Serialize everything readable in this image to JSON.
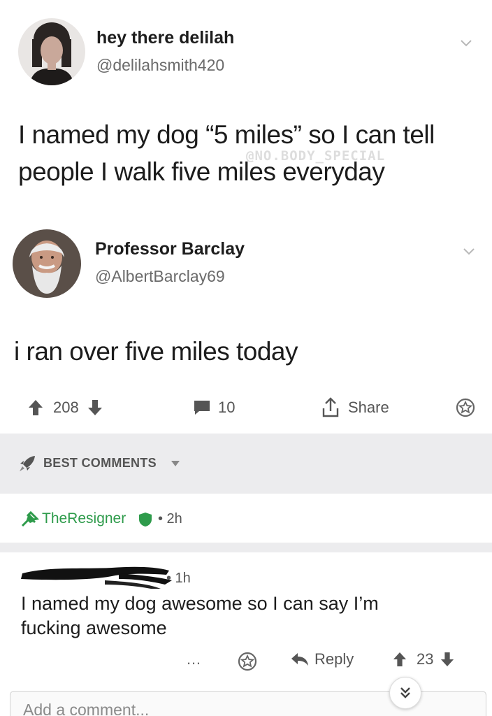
{
  "tweet1": {
    "name": "hey there delilah",
    "handle": "@delilahsmith420",
    "text": "I named my dog “5 miles” so I can tell people I walk five miles everyday",
    "watermark": "@NO.BODY_SPECIAL"
  },
  "tweet2": {
    "name": "Professor Barclay",
    "handle": "@AlbertBarclay69",
    "text": "i ran over five miles today"
  },
  "post_actions": {
    "score": "208",
    "comments": "10",
    "share_label": "Share"
  },
  "best_comments_label": "BEST COMMENTS",
  "comment1": {
    "author": "TheResigner",
    "time": "• 2h"
  },
  "comment2": {
    "time": "• 1h",
    "text": "I named my dog awesome so I can say I’m fucking awesome",
    "more": "…",
    "reply_label": "Reply",
    "score": "23"
  },
  "add_comment": {
    "placeholder": "Add a comment..."
  },
  "colors": {
    "accent_green": "#2e9b4b",
    "section_gray": "#ececee",
    "text_gray": "#555555"
  },
  "icons": {
    "upvote": "upvote-arrow-icon",
    "downvote": "downvote-arrow-icon",
    "comment": "comment-bubble-icon",
    "share": "share-icon",
    "save": "star-icon",
    "reply": "reply-arrow-icon",
    "jump": "double-chevron-down-icon"
  }
}
